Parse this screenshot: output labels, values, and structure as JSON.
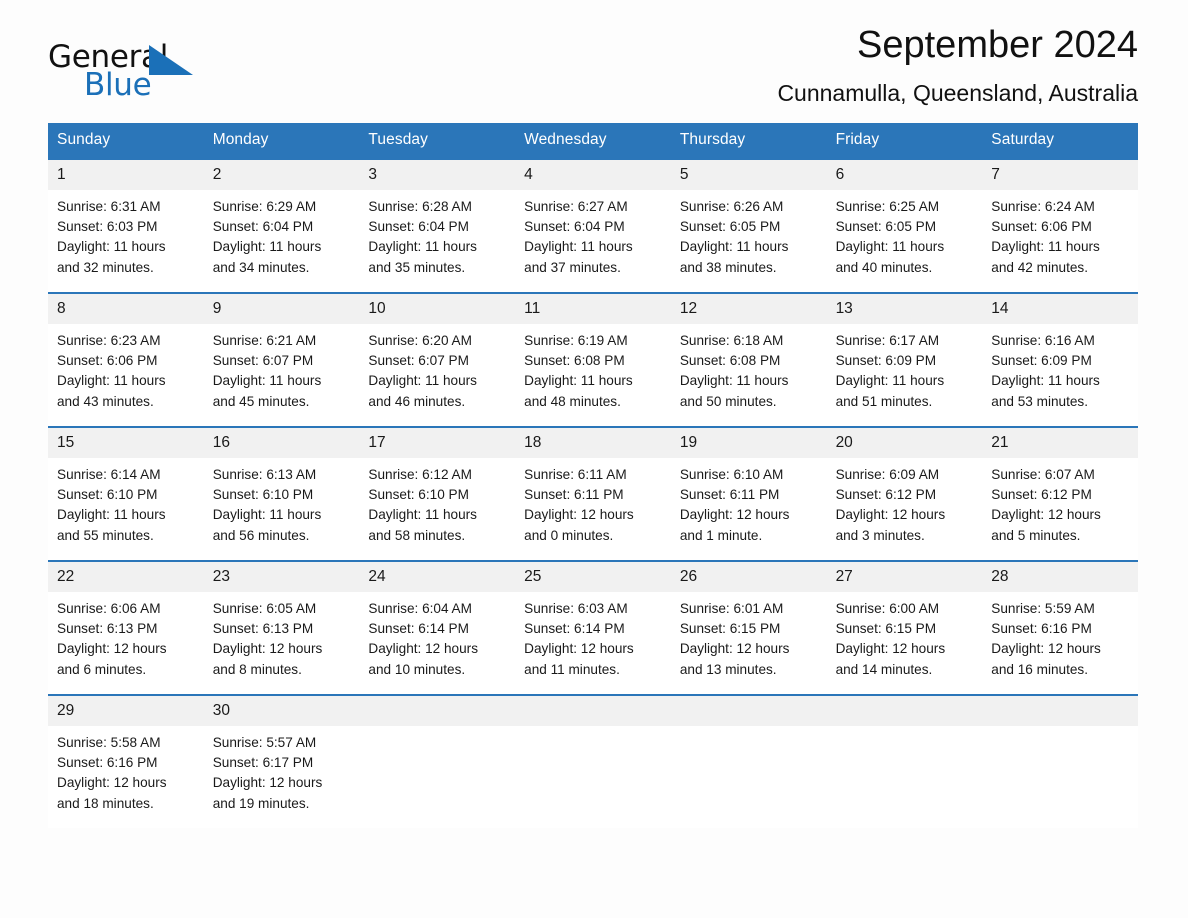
{
  "brand": {
    "name_part1": "General",
    "name_part2": "Blue",
    "triangle_color": "#1b70b8"
  },
  "header": {
    "title": "September 2024",
    "subtitle": "Cunnamulla, Queensland, Australia"
  },
  "colors": {
    "header_blue": "#2b76b9",
    "daynum_band": "#f1f1f1",
    "text": "#1a1a1a",
    "page_background": "#fdfdfd"
  },
  "weekdays": [
    "Sunday",
    "Monday",
    "Tuesday",
    "Wednesday",
    "Thursday",
    "Friday",
    "Saturday"
  ],
  "weeks": [
    {
      "days": [
        {
          "num": "1",
          "sunrise": "Sunrise: 6:31 AM",
          "sunset": "Sunset: 6:03 PM",
          "daylight_line1": "Daylight: 11 hours",
          "daylight_line2": "and 32 minutes."
        },
        {
          "num": "2",
          "sunrise": "Sunrise: 6:29 AM",
          "sunset": "Sunset: 6:04 PM",
          "daylight_line1": "Daylight: 11 hours",
          "daylight_line2": "and 34 minutes."
        },
        {
          "num": "3",
          "sunrise": "Sunrise: 6:28 AM",
          "sunset": "Sunset: 6:04 PM",
          "daylight_line1": "Daylight: 11 hours",
          "daylight_line2": "and 35 minutes."
        },
        {
          "num": "4",
          "sunrise": "Sunrise: 6:27 AM",
          "sunset": "Sunset: 6:04 PM",
          "daylight_line1": "Daylight: 11 hours",
          "daylight_line2": "and 37 minutes."
        },
        {
          "num": "5",
          "sunrise": "Sunrise: 6:26 AM",
          "sunset": "Sunset: 6:05 PM",
          "daylight_line1": "Daylight: 11 hours",
          "daylight_line2": "and 38 minutes."
        },
        {
          "num": "6",
          "sunrise": "Sunrise: 6:25 AM",
          "sunset": "Sunset: 6:05 PM",
          "daylight_line1": "Daylight: 11 hours",
          "daylight_line2": "and 40 minutes."
        },
        {
          "num": "7",
          "sunrise": "Sunrise: 6:24 AM",
          "sunset": "Sunset: 6:06 PM",
          "daylight_line1": "Daylight: 11 hours",
          "daylight_line2": "and 42 minutes."
        }
      ]
    },
    {
      "days": [
        {
          "num": "8",
          "sunrise": "Sunrise: 6:23 AM",
          "sunset": "Sunset: 6:06 PM",
          "daylight_line1": "Daylight: 11 hours",
          "daylight_line2": "and 43 minutes."
        },
        {
          "num": "9",
          "sunrise": "Sunrise: 6:21 AM",
          "sunset": "Sunset: 6:07 PM",
          "daylight_line1": "Daylight: 11 hours",
          "daylight_line2": "and 45 minutes."
        },
        {
          "num": "10",
          "sunrise": "Sunrise: 6:20 AM",
          "sunset": "Sunset: 6:07 PM",
          "daylight_line1": "Daylight: 11 hours",
          "daylight_line2": "and 46 minutes."
        },
        {
          "num": "11",
          "sunrise": "Sunrise: 6:19 AM",
          "sunset": "Sunset: 6:08 PM",
          "daylight_line1": "Daylight: 11 hours",
          "daylight_line2": "and 48 minutes."
        },
        {
          "num": "12",
          "sunrise": "Sunrise: 6:18 AM",
          "sunset": "Sunset: 6:08 PM",
          "daylight_line1": "Daylight: 11 hours",
          "daylight_line2": "and 50 minutes."
        },
        {
          "num": "13",
          "sunrise": "Sunrise: 6:17 AM",
          "sunset": "Sunset: 6:09 PM",
          "daylight_line1": "Daylight: 11 hours",
          "daylight_line2": "and 51 minutes."
        },
        {
          "num": "14",
          "sunrise": "Sunrise: 6:16 AM",
          "sunset": "Sunset: 6:09 PM",
          "daylight_line1": "Daylight: 11 hours",
          "daylight_line2": "and 53 minutes."
        }
      ]
    },
    {
      "days": [
        {
          "num": "15",
          "sunrise": "Sunrise: 6:14 AM",
          "sunset": "Sunset: 6:10 PM",
          "daylight_line1": "Daylight: 11 hours",
          "daylight_line2": "and 55 minutes."
        },
        {
          "num": "16",
          "sunrise": "Sunrise: 6:13 AM",
          "sunset": "Sunset: 6:10 PM",
          "daylight_line1": "Daylight: 11 hours",
          "daylight_line2": "and 56 minutes."
        },
        {
          "num": "17",
          "sunrise": "Sunrise: 6:12 AM",
          "sunset": "Sunset: 6:10 PM",
          "daylight_line1": "Daylight: 11 hours",
          "daylight_line2": "and 58 minutes."
        },
        {
          "num": "18",
          "sunrise": "Sunrise: 6:11 AM",
          "sunset": "Sunset: 6:11 PM",
          "daylight_line1": "Daylight: 12 hours",
          "daylight_line2": "and 0 minutes."
        },
        {
          "num": "19",
          "sunrise": "Sunrise: 6:10 AM",
          "sunset": "Sunset: 6:11 PM",
          "daylight_line1": "Daylight: 12 hours",
          "daylight_line2": "and 1 minute."
        },
        {
          "num": "20",
          "sunrise": "Sunrise: 6:09 AM",
          "sunset": "Sunset: 6:12 PM",
          "daylight_line1": "Daylight: 12 hours",
          "daylight_line2": "and 3 minutes."
        },
        {
          "num": "21",
          "sunrise": "Sunrise: 6:07 AM",
          "sunset": "Sunset: 6:12 PM",
          "daylight_line1": "Daylight: 12 hours",
          "daylight_line2": "and 5 minutes."
        }
      ]
    },
    {
      "days": [
        {
          "num": "22",
          "sunrise": "Sunrise: 6:06 AM",
          "sunset": "Sunset: 6:13 PM",
          "daylight_line1": "Daylight: 12 hours",
          "daylight_line2": "and 6 minutes."
        },
        {
          "num": "23",
          "sunrise": "Sunrise: 6:05 AM",
          "sunset": "Sunset: 6:13 PM",
          "daylight_line1": "Daylight: 12 hours",
          "daylight_line2": "and 8 minutes."
        },
        {
          "num": "24",
          "sunrise": "Sunrise: 6:04 AM",
          "sunset": "Sunset: 6:14 PM",
          "daylight_line1": "Daylight: 12 hours",
          "daylight_line2": "and 10 minutes."
        },
        {
          "num": "25",
          "sunrise": "Sunrise: 6:03 AM",
          "sunset": "Sunset: 6:14 PM",
          "daylight_line1": "Daylight: 12 hours",
          "daylight_line2": "and 11 minutes."
        },
        {
          "num": "26",
          "sunrise": "Sunrise: 6:01 AM",
          "sunset": "Sunset: 6:15 PM",
          "daylight_line1": "Daylight: 12 hours",
          "daylight_line2": "and 13 minutes."
        },
        {
          "num": "27",
          "sunrise": "Sunrise: 6:00 AM",
          "sunset": "Sunset: 6:15 PM",
          "daylight_line1": "Daylight: 12 hours",
          "daylight_line2": "and 14 minutes."
        },
        {
          "num": "28",
          "sunrise": "Sunrise: 5:59 AM",
          "sunset": "Sunset: 6:16 PM",
          "daylight_line1": "Daylight: 12 hours",
          "daylight_line2": "and 16 minutes."
        }
      ]
    },
    {
      "days": [
        {
          "num": "29",
          "sunrise": "Sunrise: 5:58 AM",
          "sunset": "Sunset: 6:16 PM",
          "daylight_line1": "Daylight: 12 hours",
          "daylight_line2": "and 18 minutes."
        },
        {
          "num": "30",
          "sunrise": "Sunrise: 5:57 AM",
          "sunset": "Sunset: 6:17 PM",
          "daylight_line1": "Daylight: 12 hours",
          "daylight_line2": "and 19 minutes."
        },
        {
          "num": "",
          "sunrise": "",
          "sunset": "",
          "daylight_line1": "",
          "daylight_line2": ""
        },
        {
          "num": "",
          "sunrise": "",
          "sunset": "",
          "daylight_line1": "",
          "daylight_line2": ""
        },
        {
          "num": "",
          "sunrise": "",
          "sunset": "",
          "daylight_line1": "",
          "daylight_line2": ""
        },
        {
          "num": "",
          "sunrise": "",
          "sunset": "",
          "daylight_line1": "",
          "daylight_line2": ""
        },
        {
          "num": "",
          "sunrise": "",
          "sunset": "",
          "daylight_line1": "",
          "daylight_line2": ""
        }
      ]
    }
  ]
}
